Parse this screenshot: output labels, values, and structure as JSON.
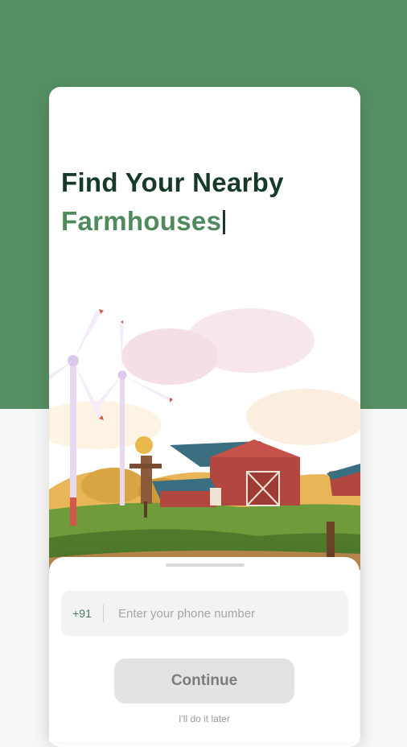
{
  "headline": {
    "line1": "Find Your Nearby",
    "line2": "Farmhouses"
  },
  "illustration": {
    "subject": "farm scene with wind turbines, scarecrow and red barn with solar panels"
  },
  "phone": {
    "country_code": "+91",
    "placeholder": "Enter your phone number",
    "value": ""
  },
  "actions": {
    "continue_label": "Continue",
    "skip_label": "I'll do it later"
  },
  "colors": {
    "brand_green": "#568f64",
    "headline_dark": "#163a26",
    "accent_green": "#4f8a5f",
    "button_disabled": "#e3e3e3"
  }
}
